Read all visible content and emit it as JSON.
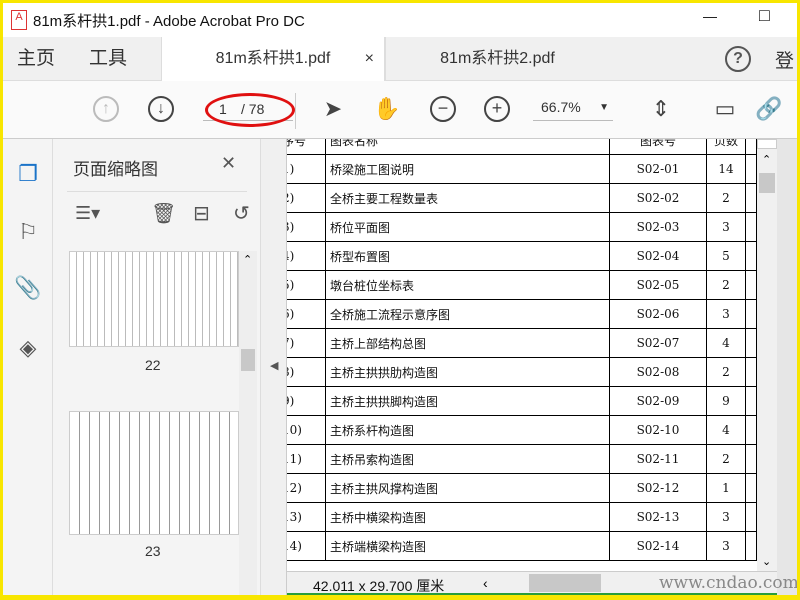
{
  "window": {
    "title": "81m系杆拱1.pdf - Adobe Acrobat Pro DC",
    "minimize": "—",
    "maximize": "□"
  },
  "nav": {
    "home": "主页",
    "tools": "工具"
  },
  "tabs": [
    {
      "label": "81m系杆拱1.pdf",
      "close": "×",
      "active": true
    },
    {
      "label": "81m系杆拱2.pdf",
      "active": false
    }
  ],
  "header_right": {
    "help": "?",
    "signin": "登"
  },
  "toolbar": {
    "page_current": "1",
    "page_total": "/ 78",
    "zoom": "66.7%"
  },
  "thumbnail_panel": {
    "title": "页面缩略图",
    "close": "✕",
    "pages": [
      "22",
      "23"
    ]
  },
  "table": {
    "headers": [
      "序号",
      "图表名称",
      "图表号",
      "页数"
    ],
    "rows": [
      [
        "1)",
        "桥梁施工图说明",
        "S02-01",
        "14"
      ],
      [
        "2)",
        "全桥主要工程数量表",
        "S02-02",
        "2"
      ],
      [
        "3)",
        "桥位平面图",
        "S02-03",
        "3"
      ],
      [
        "4)",
        "桥型布置图",
        "S02-04",
        "5"
      ],
      [
        "5)",
        "墩台桩位坐标表",
        "S02-05",
        "2"
      ],
      [
        "6)",
        "全桥施工流程示意序图",
        "S02-06",
        "3"
      ],
      [
        "7)",
        "主桥上部结构总图",
        "S02-07",
        "4"
      ],
      [
        "8)",
        "主桥主拱拱肋构造图",
        "S02-08",
        "2"
      ],
      [
        "9)",
        "主桥主拱拱脚构造图",
        "S02-09",
        "9"
      ],
      [
        "10)",
        "主桥系杆构造图",
        "S02-10",
        "4"
      ],
      [
        "11)",
        "主桥吊索构造图",
        "S02-11",
        "2"
      ],
      [
        "12)",
        "主桥主拱风撑构造图",
        "S02-12",
        "1"
      ],
      [
        "13)",
        "主桥中横梁构造图",
        "S02-13",
        "3"
      ],
      [
        "14)",
        "主桥端横梁构造图",
        "S02-14",
        "3"
      ]
    ]
  },
  "status": {
    "page_size": "42.011 x 29.700 厘米"
  },
  "watermark": "www.cndao.com",
  "colors": {
    "accent": "#1a73c8",
    "annotation": "#e01010",
    "frame": "#f8e600"
  }
}
